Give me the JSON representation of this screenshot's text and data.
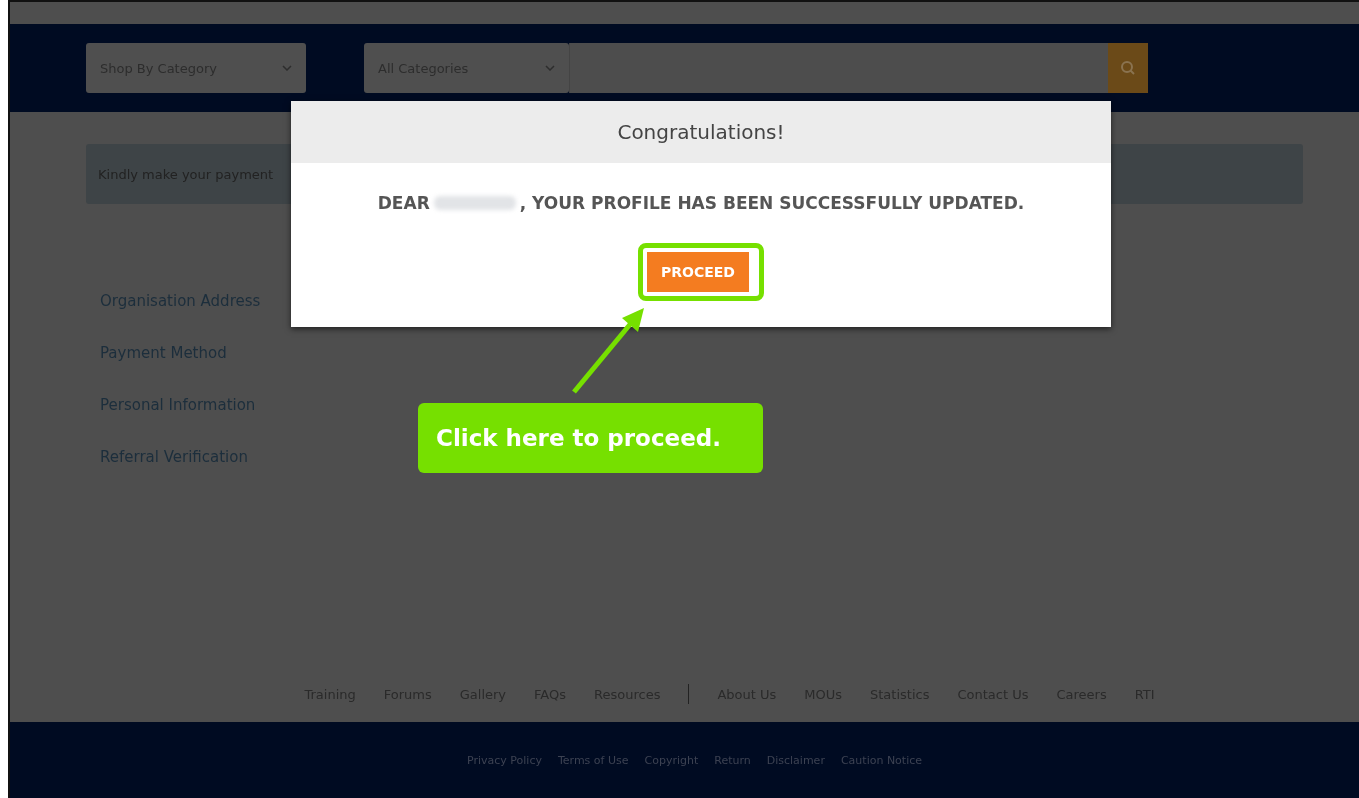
{
  "header": {
    "category_select": "Shop By Category",
    "search_category": "All Categories"
  },
  "notice": {
    "text": "Kindly make your payment"
  },
  "sidebar": {
    "items": [
      "Organisation Address",
      "Payment Method",
      "Personal Information",
      "Referral Verification"
    ]
  },
  "footer": {
    "link_groups": [
      [
        "Training",
        "Forums",
        "Gallery",
        "FAQs",
        "Resources"
      ],
      [
        "About Us",
        "MOUs",
        "Statistics",
        "Contact Us",
        "Careers",
        "RTI"
      ]
    ],
    "bottom_links": [
      "Privacy Policy",
      "Terms of Use",
      "Copyright",
      "Return",
      "Disclaimer",
      "Caution Notice"
    ]
  },
  "modal": {
    "title": "Congratulations!",
    "greeting": "DEAR",
    "message": ", YOUR PROFILE HAS BEEN SUCCESSFULLY UPDATED.",
    "button": "PROCEED"
  },
  "callout": {
    "text": "Click here to proceed."
  }
}
